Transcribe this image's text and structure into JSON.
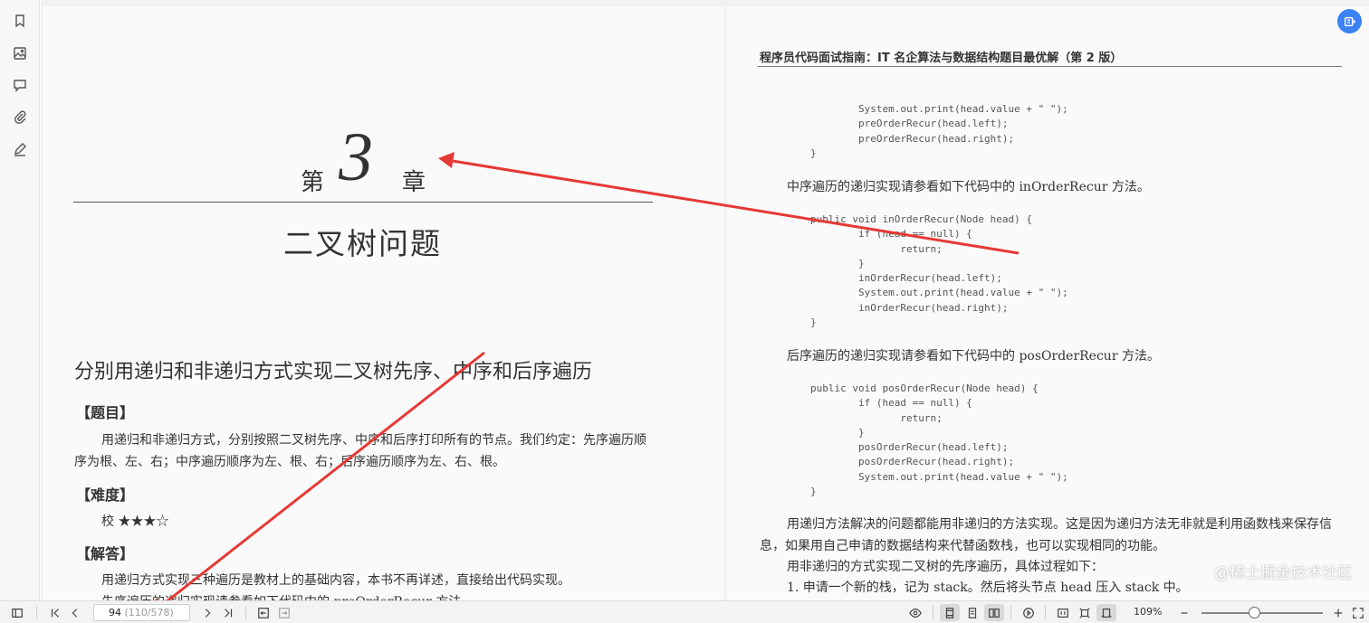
{
  "left_page": {
    "chapter_prefix": "第",
    "chapter_number": "3",
    "chapter_suffix": "章",
    "chapter_title": "二叉树问题",
    "section_heading": "分别用递归和非递归方式实现二叉树先序、中序和后序遍历",
    "problem_label": "【题目】",
    "problem_text": "用递归和非递归方式，分别按照二叉树先序、中序和后序打印所有的节点。我们约定：先序遍历顺序为根、左、右；中序遍历顺序为左、根、右；后序遍历顺序为左、右、根。",
    "difficulty_label": "【难度】",
    "difficulty_value": "校 ★★★☆",
    "answer_label": "【解答】",
    "answer_line1": "用递归方式实现三种遍历是教材上的基础内容，本书不再详述，直接给出代码实现。",
    "answer_line2": "先序遍历的递归实现请参看如下代码中的 preOrderRecur 方法。"
  },
  "right_page": {
    "running_head": "程序员代码面试指南：IT 名企算法与数据结构题目最优解（第 2 版）",
    "code_pre_tail": "        System.out.print(head.value + \" \");\n        preOrderRecur(head.left);\n        preOrderRecur(head.right);\n}",
    "inorder_intro": "中序遍历的递归实现请参看如下代码中的 inOrderRecur 方法。",
    "code_in": "public void inOrderRecur(Node head) {\n        if (head == null) {\n               return;\n        }\n        inOrderRecur(head.left);\n        System.out.print(head.value + \" \");\n        inOrderRecur(head.right);\n}",
    "postorder_intro": "后序遍历的递归实现请参看如下代码中的 posOrderRecur 方法。",
    "code_post": "public void posOrderRecur(Node head) {\n        if (head == null) {\n               return;\n        }\n        posOrderRecur(head.left);\n        posOrderRecur(head.right);\n        System.out.print(head.value + \" \");\n}",
    "para1": "用递归方法解决的问题都能用非递归的方法实现。这是因为递归方法无非就是利用函数栈来保存信息，如果用自己申请的数据结构来代替函数栈，也可以实现相同的功能。",
    "para2": "用非递归的方式实现二叉树的先序遍历，具体过程如下：",
    "para3": "1. 申请一个新的栈，记为 stack。然后将头节点 head 压入 stack 中。"
  },
  "watermark": "@稀土掘金技术社区",
  "toolbar": {
    "page_number": "94",
    "page_of": "(110/578)",
    "zoom": "109%",
    "zoom_fraction": 0.44
  },
  "colors": {
    "annotation_arrow": "#e53935",
    "fab_blue": "#3b82f6"
  },
  "icons": {
    "sidebar": [
      "bookmark-icon",
      "image-icon",
      "comment-icon",
      "attachment-icon",
      "signature-icon"
    ],
    "toolbar": [
      "sidebar-toggle-icon",
      "first-page-icon",
      "prev-page-icon",
      "next-page-icon",
      "last-page-icon",
      "back-icon",
      "forward-icon",
      "eye-icon",
      "single-page-icon",
      "continuous-icon",
      "two-page-icon",
      "play-icon",
      "actual-size-icon",
      "fit-page-icon",
      "fit-width-icon",
      "zoom-out-icon",
      "zoom-in-icon",
      "fullscreen-icon"
    ]
  }
}
